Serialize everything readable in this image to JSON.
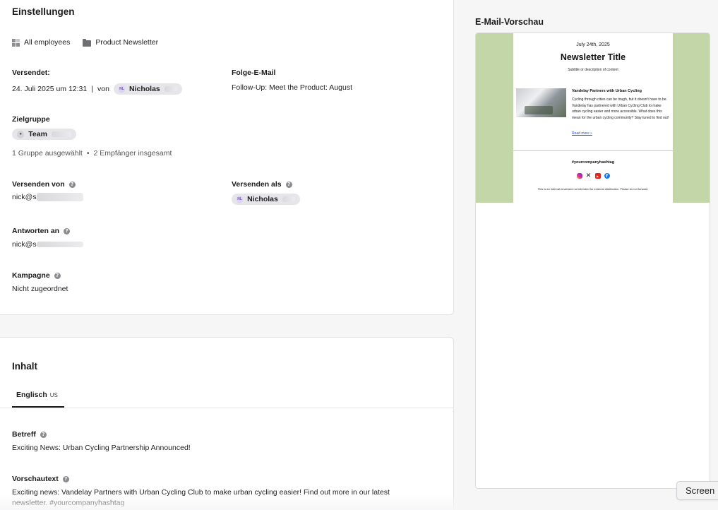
{
  "settings": {
    "heading": "Einstellungen",
    "audience_label": "All employees",
    "folder_label": "Product Newsletter",
    "sent": {
      "label": "Versendet:",
      "date": "24. Juli 2025 um 12:31",
      "separator": "|",
      "by": "von",
      "sender_initials": "NL",
      "sender_name": "Nicholas"
    },
    "followup": {
      "label": "Folge-E-Mail",
      "value": "Follow-Up: Meet the Product: August"
    },
    "target": {
      "label": "Zielgruppe",
      "group_name": "Team",
      "summary_groups": "1 Gruppe ausgewählt",
      "bullet": "•",
      "summary_recipients": "2 Empfänger insgesamt"
    },
    "send_from": {
      "label": "Versenden von",
      "value": "nick@s"
    },
    "send_as": {
      "label": "Versenden als",
      "initials": "NL",
      "name": "Nicholas"
    },
    "reply_to": {
      "label": "Antworten an",
      "value": "nick@s"
    },
    "campaign": {
      "label": "Kampagne",
      "value": "Nicht zugeordnet"
    }
  },
  "content": {
    "heading": "Inhalt",
    "tab_label": "Englisch",
    "tab_locale": "US",
    "subject": {
      "label": "Betreff",
      "value": "Exciting News: Urban Cycling Partnership Announced!"
    },
    "preview_text": {
      "label": "Vorschautext",
      "line1": "Exciting news: Vandelay Partners with Urban Cycling Club to make urban cycling easier! Find out more in our latest",
      "line2": "newsletter. #yourcompanyhashtag"
    }
  },
  "preview": {
    "heading": "E-Mail-Vorschau",
    "date": "July 24th, 2025",
    "title": "Newsletter Title",
    "subtitle": "Subtitle or description of content",
    "article_title": "Vandelay Partners with Urban Cycling",
    "article_text": "Cycling through cities can be tough, but it doesn't have to be. Vandelay has partnered with Urban Cycling Club to make urban cycling easier and more accessible. What does this mean for the urban cycling community? Stay tuned to find out!",
    "read_more": "Read more »",
    "hashtag": "#yourcompanyhashtag",
    "footer": "This is an internal email and not intended for external distribution. Please do not forward.",
    "colors": {
      "side_band": "#c3d6a7",
      "link": "#1a56c5"
    },
    "social_icons": [
      "instagram-icon",
      "x-icon",
      "youtube-icon",
      "facebook-icon"
    ]
  },
  "overlay": {
    "screen_tab": "Screen"
  }
}
